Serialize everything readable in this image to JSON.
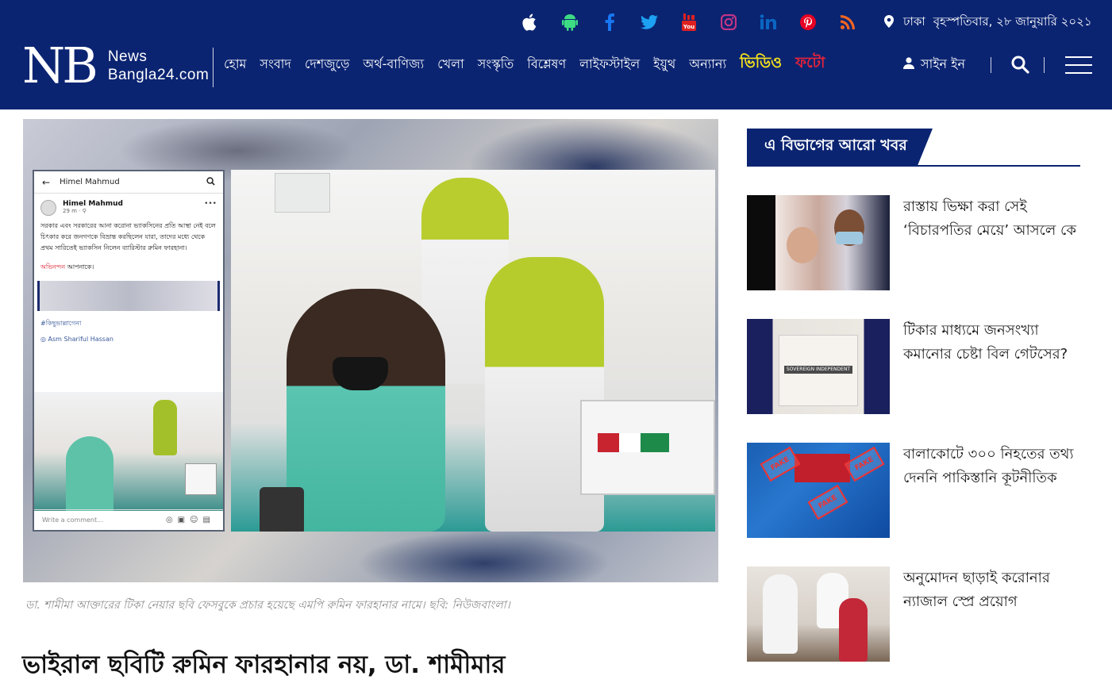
{
  "header": {
    "logo_mark": "NB",
    "logo_line1": "News",
    "logo_line2": "Bangla24.com",
    "social_icons": [
      "apple-icon",
      "android-icon",
      "facebook-icon",
      "twitter-icon",
      "youtube-icon",
      "instagram-icon",
      "linkedin-icon",
      "pinterest-icon",
      "rss-icon"
    ],
    "social_colors": {
      "apple": "#ffffff",
      "android": "#3ddc84",
      "facebook": "#1877f2",
      "twitter": "#1da1f2",
      "youtube": "#e02020",
      "instagram": "#c13584",
      "linkedin": "#0a66c2",
      "pinterest": "#e60023",
      "rss": "#f26522"
    },
    "location": "ঢাকা",
    "date": "বৃহস্পতিবার, ২৮ জানুয়ারি ২০২১",
    "nav": [
      "হোম",
      "সংবাদ",
      "দেশজুড়ে",
      "অর্থ-বাণিজ্য",
      "খেলা",
      "সংস্কৃতি",
      "বিশ্লেষণ",
      "লাইফস্টাইল",
      "ইয়ুথ",
      "অন্যান্য"
    ],
    "nav_video": "ভিডিও",
    "nav_photo": "ফটো",
    "signin": "সাইন ইন",
    "bg_color": "#0b2472"
  },
  "hero": {
    "fb_header_name": "Himel Mahmud",
    "fb_author": "Himel Mahmud",
    "fb_time": "29 m · ⚲",
    "fb_body": "সরকার এবং সরকারের আনা করোনা ভ্যাকসিনের প্রতি আস্থা নেই বলে চিৎকার করে জনগণকে বিভ্রান্ত করছিলেন যারা, তাদের মধ্যে থেকে প্রথম সারিতেই ভ্যাকসিন নিলেন ব্যারিস্টার রুমিন ফারহানা।",
    "fb_congrats_red": "অভিনন্দন",
    "fb_congrats_rest": " আপনাকে।",
    "fb_hashtag": "#কিছুভাল্লাগেনা",
    "fb_credit": "Asm Shariful Hassan",
    "fb_comment_placeholder": "Write a comment..."
  },
  "caption": "ডা. শামীমা আক্তারের টিকা নেয়ার ছবি ফেসবুকে প্রচার হয়েছে এমপি রুমিন ফারহানার নামে। ছবি: নিউজবাংলা।",
  "headline": "ভাইরাল ছবিটি রুমিন ফারহানার নয়, ডা. শামীমার",
  "sidebar": {
    "title": "এ বিভাগের আরো খবর",
    "items": [
      {
        "text": "রাস্তায় ভিক্ষা করা সেই ‘বিচারপতির মেয়ে’ আসলে কে"
      },
      {
        "text": "টিকার মাধ্যমে জনসংখ্যা কমানোর চেষ্টা বিল গেটসের?",
        "thumb_caption": "SOVEREIGN INDEPENDENT"
      },
      {
        "text": "বালাকোটে ৩০০ নিহতের তথ্য দেননি পাকিস্তানি কূটনীতিক",
        "thumb_stamp": "FAKE"
      },
      {
        "text": "অনুমোদন ছাড়াই করোনার ন্যাজাল স্প্রে প্রয়োগ"
      }
    ]
  }
}
